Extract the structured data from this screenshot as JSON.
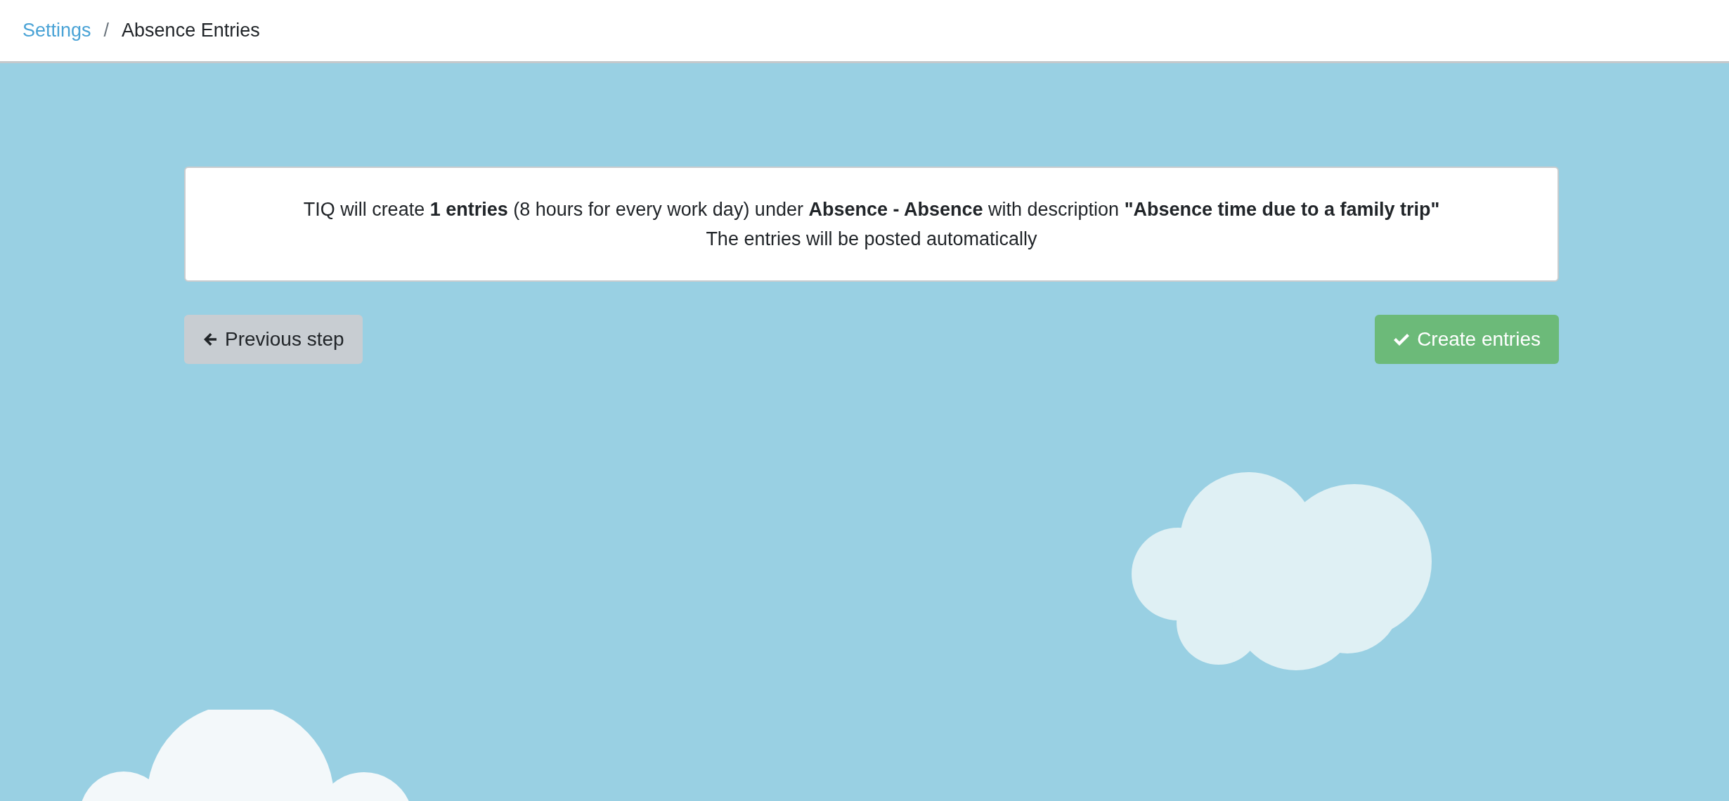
{
  "breadcrumb": [
    {
      "label": "Settings",
      "kind": "link"
    },
    {
      "label": "Absence Entries",
      "kind": "current"
    }
  ],
  "breadcrumb_separator": "/",
  "summary": {
    "lines": [
      "TIQ will create **1 entries** (8 hours for every work day) under **Absence - Absence** with description **\"Absence time due to a family trip\"**",
      "The entries will be posted automatically"
    ]
  },
  "buttons": [
    {
      "label": "Previous step",
      "kind": "back"
    },
    {
      "label": "Create entries",
      "kind": "confirm"
    }
  ]
}
